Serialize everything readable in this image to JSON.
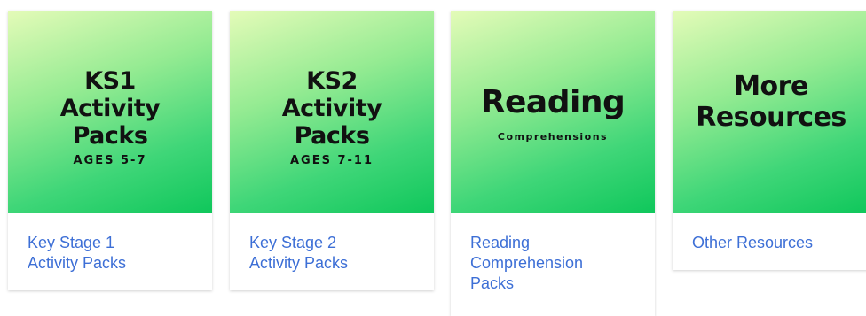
{
  "cards": [
    {
      "thumb_lines": [
        "KS1",
        "Activity",
        "Packs"
      ],
      "thumb_sub": "AGES 5-7",
      "link_lines": [
        "Key Stage 1",
        "Activity Packs"
      ]
    },
    {
      "thumb_lines": [
        "KS2",
        "Activity",
        "Packs"
      ],
      "thumb_sub": "AGES 7-11",
      "link_lines": [
        "Key Stage 2",
        "Activity Packs"
      ]
    },
    {
      "thumb_lines": [
        "Reading"
      ],
      "thumb_sub": "Comprehensions",
      "link_lines": [
        "Reading",
        "Comprehension",
        "Packs"
      ]
    },
    {
      "thumb_lines": [
        "More",
        "Resources"
      ],
      "thumb_sub": "",
      "link_lines": [
        "Other Resources"
      ]
    }
  ],
  "colors": {
    "link": "#3d6fd6",
    "gradient_top": "#e4fbb8",
    "gradient_bottom": "#0fc75b"
  }
}
